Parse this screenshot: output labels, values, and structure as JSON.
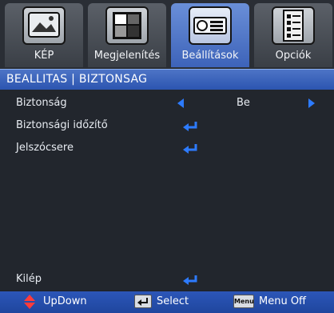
{
  "tabs": [
    {
      "label": "KÉP",
      "icon": "picture-icon",
      "active": false
    },
    {
      "label": "Megjelenítés",
      "icon": "display-icon",
      "active": false
    },
    {
      "label": "Beállítások",
      "icon": "projector-icon",
      "active": true
    },
    {
      "label": "Opciók",
      "icon": "options-icon",
      "active": false
    }
  ],
  "title": "BEALLITAS | BIZTONSAG",
  "rows": [
    {
      "label": "Biztonság",
      "value": "Be",
      "control": "left-right-arrows"
    },
    {
      "label": "Biztonsági időzítő",
      "control": "enter-icon"
    },
    {
      "label": "Jelszócsere",
      "control": "enter-icon"
    }
  ],
  "exit": {
    "label": "Kilép",
    "control": "enter-icon"
  },
  "footer": {
    "updown": "UpDown",
    "select": "Select",
    "menu_key": "Menu",
    "menu_off": "Menu Off"
  },
  "colors": {
    "accent": "#3d63b9",
    "arrow": "#2d7bff",
    "enter_icon": "#2d7bff"
  }
}
